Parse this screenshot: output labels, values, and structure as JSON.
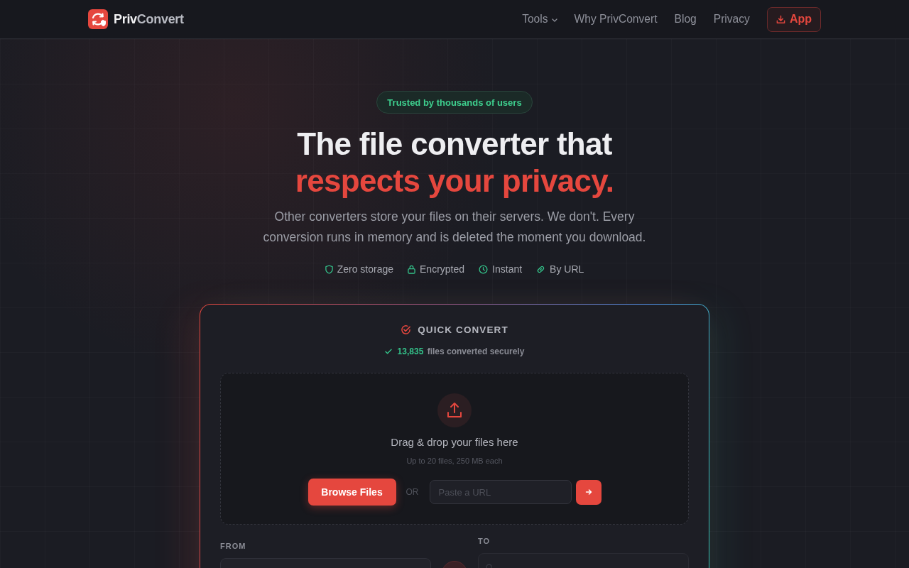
{
  "header": {
    "brand": {
      "parts": [
        "Priv",
        "Convert"
      ]
    },
    "nav": [
      {
        "label": "Tools",
        "kind": "dropdown"
      },
      {
        "label": "Why PrivConvert",
        "kind": "link"
      },
      {
        "label": "Blog",
        "kind": "link"
      },
      {
        "label": "Privacy",
        "kind": "link"
      }
    ],
    "app_button": {
      "label": "App"
    }
  },
  "hero": {
    "badge": "Trusted by thousands of users",
    "title_line_1": "The file converter that",
    "title_line_2": "respects your privacy.",
    "subtitle": "Other converters store your files on their servers. We don't. Every conversion runs in memory and is deleted the moment you download.",
    "features": [
      {
        "label": "Zero storage",
        "kind": "shield"
      },
      {
        "label": "Encrypted",
        "kind": "lock"
      },
      {
        "label": "Instant",
        "kind": "clock"
      },
      {
        "label": "By URL",
        "kind": "link"
      }
    ]
  },
  "converter": {
    "title": "QUICK CONVERT",
    "count_line": "**13,835** files converted securely",
    "dropzone": {
      "heading": "Drag & drop your files here",
      "hint": "Up to 20 files, 250 MB each",
      "browse_button": "Browse Files",
      "separator": "OR",
      "url_field": {
        "placeholder": "Paste a URL"
      }
    },
    "from": {
      "label": "FROM"
    },
    "to": {
      "label": "TO"
    }
  }
}
